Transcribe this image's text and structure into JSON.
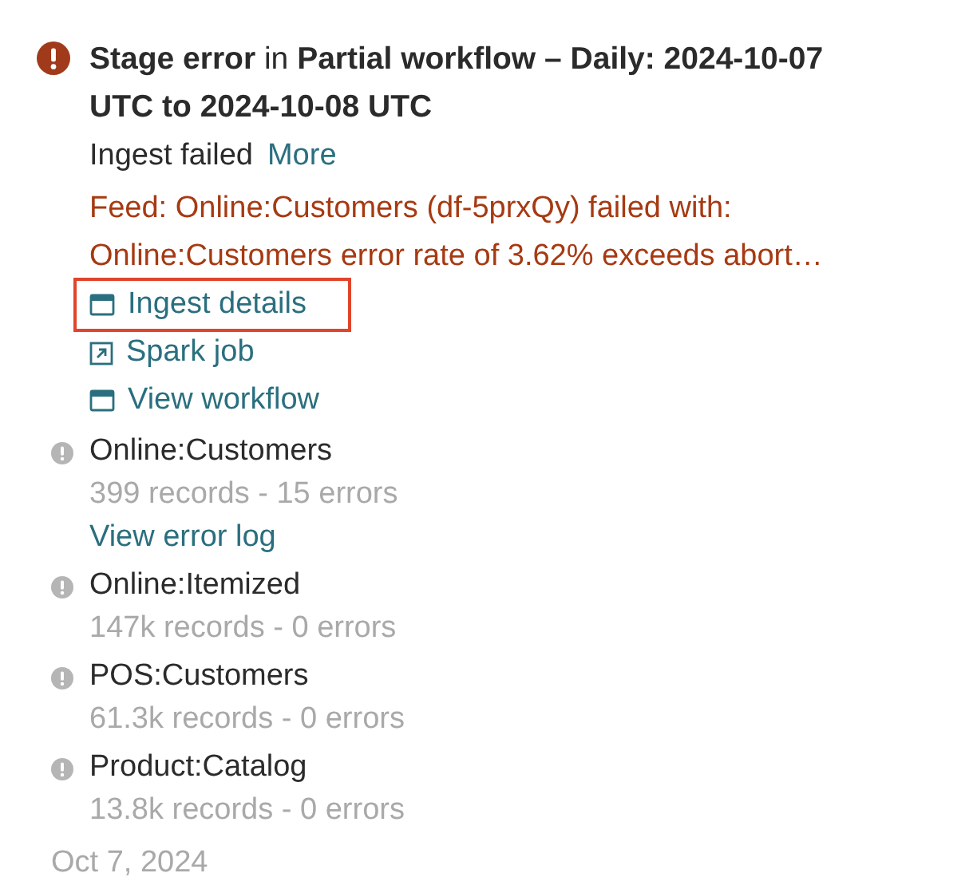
{
  "title": "**Stage error** in **Partial workflow – Daily: 2024-10-07 UTC to 2024-10-08 UTC**",
  "summary": "Ingest failed",
  "more_link": "More",
  "error_message": "Feed: Online:Customers (df-5prxQy) failed with: Online:Customers error rate of 3.62% exceeds abort…",
  "links": [
    {
      "label": "Ingest details",
      "kind": "panel",
      "highlighted": true
    },
    {
      "label": "Spark job",
      "kind": "external",
      "highlighted": false
    },
    {
      "label": "View workflow",
      "kind": "panel",
      "highlighted": false
    }
  ],
  "feeds": [
    {
      "name": "Online:Customers",
      "stats": "399 records - 15 errors",
      "link": "View error log"
    },
    {
      "name": "Online:Itemized",
      "stats": "147k records - 0 errors"
    },
    {
      "name": "POS:Customers",
      "stats": "61.3k records - 0 errors"
    },
    {
      "name": "Product:Catalog",
      "stats": "13.8k records - 0 errors"
    }
  ],
  "date": "Oct 7, 2024"
}
